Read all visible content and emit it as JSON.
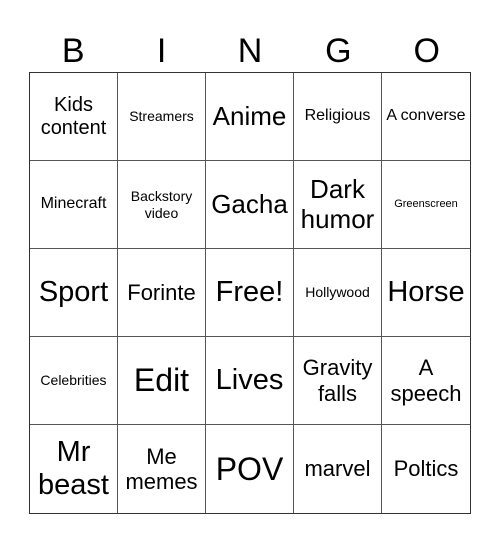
{
  "header": {
    "letters": [
      "B",
      "I",
      "N",
      "G",
      "O"
    ]
  },
  "card": {
    "cells": [
      "Kids content",
      "Streamers",
      "Anime",
      "Religious",
      "A converse",
      "Minecraft",
      "Backstory video",
      "Gacha",
      "Dark humor",
      "Greenscreen",
      "Sport",
      "Forinte",
      "Free!",
      "Hollywood",
      "Horse",
      "Celebrities",
      "Edit",
      "Lives",
      "Gravity falls",
      "A speech",
      "Mr beast",
      "Me memes",
      "POV",
      "marvel",
      "Poltics"
    ]
  }
}
